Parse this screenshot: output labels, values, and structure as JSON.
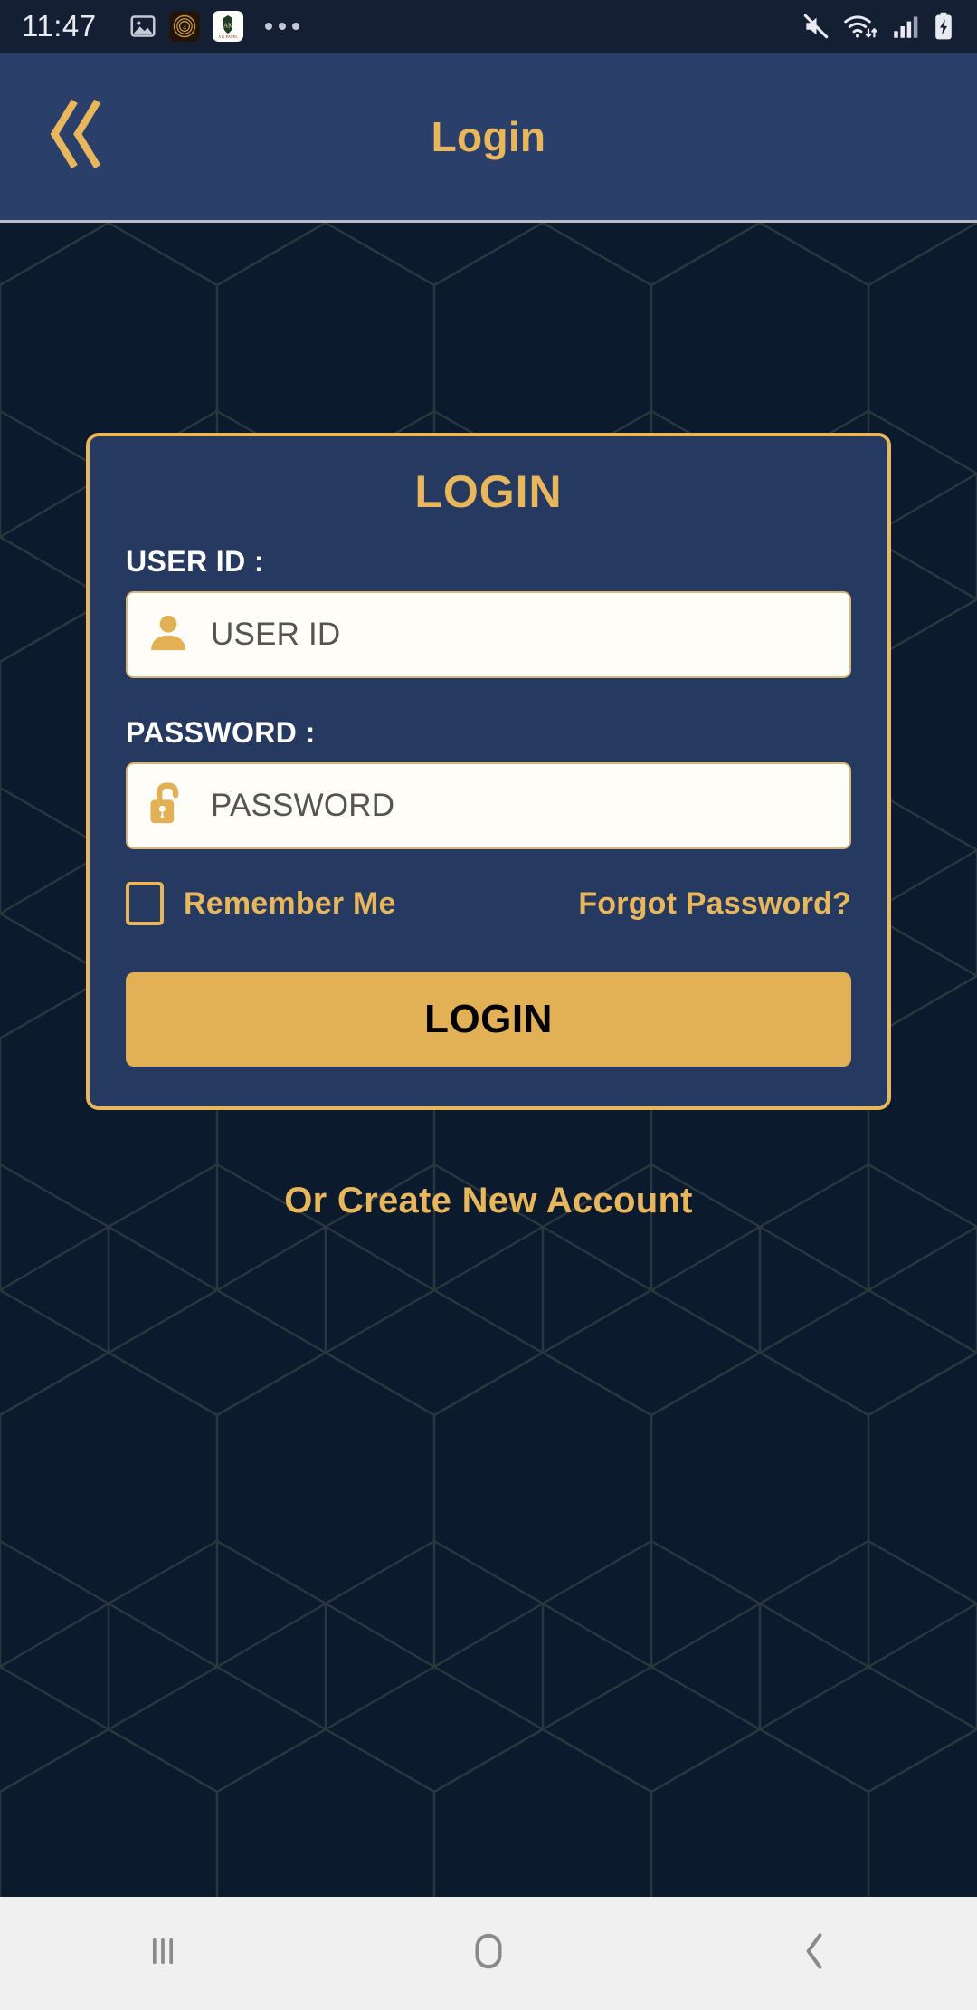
{
  "status_bar": {
    "time": "11:47",
    "left_icons": [
      {
        "name": "gallery-image-icon"
      },
      {
        "name": "gold-wreath-badge-icon"
      },
      {
        "name": "a-k-patel-app-icon",
        "label": "A K Patel"
      },
      {
        "name": "more-notifications-icon"
      }
    ],
    "right_icons": [
      {
        "name": "mute-icon"
      },
      {
        "name": "wifi-icon"
      },
      {
        "name": "cellular-signal-icon"
      },
      {
        "name": "battery-charging-icon"
      }
    ]
  },
  "header": {
    "title": "Login",
    "back_icon": "double-chevron-left-icon"
  },
  "login_card": {
    "title": "LOGIN",
    "user_id_label": "USER ID :",
    "user_id_placeholder": "USER ID",
    "user_id_value": "",
    "user_id_icon": "user-person-icon",
    "password_label": "PASSWORD :",
    "password_placeholder": "PASSWORD",
    "password_value": "",
    "password_icon": "unlocked-padlock-icon",
    "remember_me_label": "Remember Me",
    "remember_me_checked": false,
    "forgot_password_label": "Forgot Password?",
    "login_button_label": "LOGIN"
  },
  "create_account_label": "Or Create New Account",
  "nav_bar": {
    "recents_icon": "recents-icon",
    "home_icon": "home-icon",
    "back_icon": "back-chevron-icon"
  },
  "colors": {
    "gold": "#e9b75b",
    "button_gold": "#e3b155",
    "header_navy": "#2b3f6b",
    "card_navy": "#263a61",
    "page_navy": "#0b1b2d",
    "status_bar": "#151f33",
    "nav_bar": "#f0f0f0",
    "input_bg": "#fffdf7",
    "placeholder_gray": "#545454"
  }
}
